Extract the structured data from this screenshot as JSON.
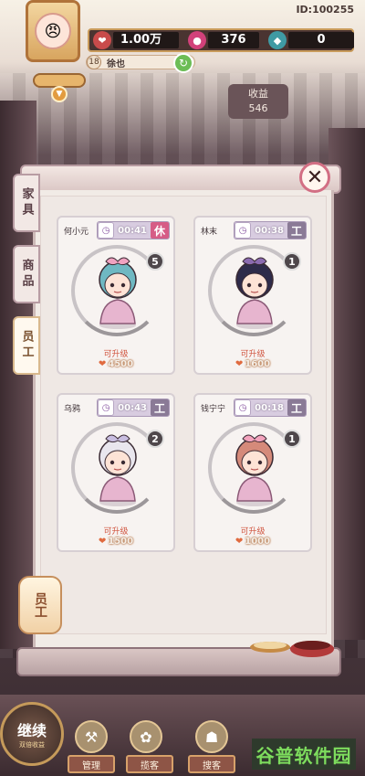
{
  "header": {
    "id_text": "ID:100255",
    "resources": [
      {
        "icon": "coin-icon",
        "value": "1.00万",
        "color": "#c94b4b"
      },
      {
        "icon": "gem-icon",
        "value": "376",
        "color": "#d2417a"
      },
      {
        "icon": "ticket-icon",
        "value": "0",
        "color": "#3f9aa3"
      }
    ],
    "player": {
      "level": "18",
      "name": "徐也"
    },
    "income": {
      "label": "收益",
      "value": "546"
    }
  },
  "tabs": [
    {
      "label": "家具",
      "active": false
    },
    {
      "label": "商品",
      "active": false
    },
    {
      "label": "员工",
      "active": true
    }
  ],
  "staff": [
    {
      "name": "何小元",
      "timer": "00:41",
      "status": "休",
      "level": "5",
      "upgrade_label": "可升级",
      "cost": "4500",
      "hair": "#6fb8c2",
      "bow": "#f0a2c0"
    },
    {
      "name": "林末",
      "timer": "00:38",
      "status": "工",
      "level": "1",
      "upgrade_label": "可升级",
      "cost": "1600",
      "hair": "#2e2b4a",
      "bow": "#8b6bb0"
    },
    {
      "name": "乌鸦",
      "timer": "00:43",
      "status": "工",
      "level": "2",
      "upgrade_label": "可升级",
      "cost": "1500",
      "hair": "#e9e6ee",
      "bow": "#c8bde0"
    },
    {
      "name": "钱宁宁",
      "timer": "00:18",
      "status": "工",
      "level": "1",
      "upgrade_label": "可升级",
      "cost": "1000",
      "hair": "#d58a7a",
      "bow": "#f3a3bd"
    }
  ],
  "lantern_label": "员工",
  "bottom": {
    "continue_big": "继续",
    "continue_small": "双倍收益",
    "nav": [
      "管理",
      "揽客",
      "搜客"
    ]
  },
  "watermark": "谷普软件园"
}
